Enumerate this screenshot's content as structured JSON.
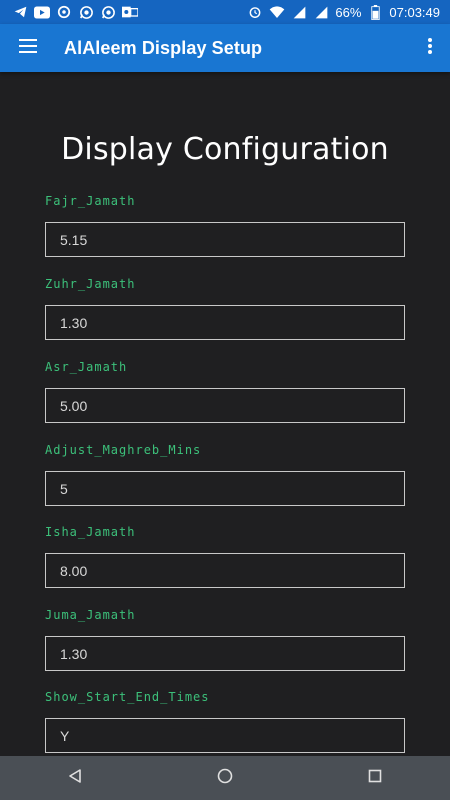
{
  "status_bar": {
    "battery": "66%",
    "time": "07:03:49",
    "left_icons": [
      "telegram-icon",
      "youtube-icon",
      "sync-icon",
      "whatsapp-icon",
      "whatsapp-icon",
      "outlook-icon"
    ],
    "right_icons": [
      "alarm-icon",
      "wifi-icon",
      "signal-icon",
      "signal-icon",
      "battery-icon"
    ]
  },
  "app_bar": {
    "title": "AlAleem Display Setup",
    "menu_icon": "hamburger-menu-icon",
    "more_icon": "more-vert-icon"
  },
  "page": {
    "title": "Display Configuration"
  },
  "fields": [
    {
      "label": "Fajr_Jamath",
      "value": "5.15"
    },
    {
      "label": "Zuhr_Jamath",
      "value": "1.30"
    },
    {
      "label": "Asr_Jamath",
      "value": "5.00"
    },
    {
      "label": "Adjust_Maghreb_Mins",
      "value": "5"
    },
    {
      "label": "Isha_Jamath",
      "value": "8.00"
    },
    {
      "label": "Juma_Jamath",
      "value": "1.30"
    },
    {
      "label": "Show_Start_End_Times",
      "value": "Y"
    }
  ],
  "colors": {
    "app_bar": "#1976d2",
    "status_bar": "#1565c0",
    "background": "#1f1f21",
    "label": "#3cc07a",
    "nav_bar": "#4a4f55"
  }
}
